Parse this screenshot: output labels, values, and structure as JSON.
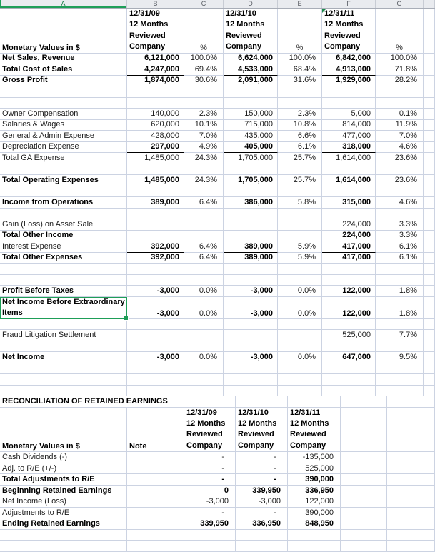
{
  "colors": {
    "selection_green": "#1E9E58",
    "header_letter_green": "#107C41",
    "flag_green": "#1E8A4E",
    "gridline": "#CCD3E2"
  },
  "column_headers": [
    "A",
    "B",
    "C",
    "D",
    "E",
    "F",
    "G",
    ""
  ],
  "income_statement": {
    "corner_label": "Monetary Values in $",
    "percent_symbol": "%",
    "periods": [
      {
        "lines": [
          "12/31/09",
          "12 Months",
          "Reviewed",
          "Company"
        ],
        "flag": false
      },
      {
        "lines": [
          "12/31/10",
          "12 Months",
          "Reviewed",
          "Company"
        ],
        "flag": false
      },
      {
        "lines": [
          "12/31/11",
          "12 Months",
          "Reviewed",
          "Company"
        ],
        "flag": true
      }
    ],
    "rows": [
      {
        "type": "data",
        "label": "Net Sales, Revenue",
        "label_bold": true,
        "value_bold": true,
        "underline": false,
        "cells": [
          "6,121,000",
          "100.0%",
          "6,624,000",
          "100.0%",
          "6,842,000",
          "100.0%"
        ]
      },
      {
        "type": "data",
        "label": "Total Cost of Sales",
        "label_bold": true,
        "value_bold": true,
        "underline": true,
        "cells": [
          "4,247,000",
          "69.4%",
          "4,533,000",
          "68.4%",
          "4,913,000",
          "71.8%"
        ]
      },
      {
        "type": "data",
        "label": "Gross Profit",
        "label_bold": true,
        "value_bold": true,
        "underline": false,
        "cells": [
          "1,874,000",
          "30.6%",
          "2,091,000",
          "31.6%",
          "1,929,000",
          "28.2%"
        ]
      },
      {
        "type": "blank"
      },
      {
        "type": "blank"
      },
      {
        "type": "data",
        "label": "Owner Compensation",
        "label_bold": false,
        "value_bold": false,
        "underline": false,
        "cells": [
          "140,000",
          "2.3%",
          "150,000",
          "2.3%",
          "5,000",
          "0.1%"
        ]
      },
      {
        "type": "data",
        "label": "Salaries & Wages",
        "label_bold": false,
        "value_bold": false,
        "underline": false,
        "cells": [
          "620,000",
          "10.1%",
          "715,000",
          "10.8%",
          "814,000",
          "11.9%"
        ]
      },
      {
        "type": "data",
        "label": "General & Admin Expense",
        "label_bold": false,
        "value_bold": false,
        "underline": false,
        "cells": [
          "428,000",
          "7.0%",
          "435,000",
          "6.6%",
          "477,000",
          "7.0%"
        ]
      },
      {
        "type": "data",
        "label": "Depreciation Expense",
        "label_bold": false,
        "value_bold": true,
        "underline": true,
        "cells": [
          "297,000",
          "4.9%",
          "405,000",
          "6.1%",
          "318,000",
          "4.6%"
        ]
      },
      {
        "type": "data",
        "label": "Total GA Expense",
        "label_bold": false,
        "value_bold": false,
        "underline": false,
        "cells": [
          "1,485,000",
          "24.3%",
          "1,705,000",
          "25.7%",
          "1,614,000",
          "23.6%"
        ]
      },
      {
        "type": "blank"
      },
      {
        "type": "data",
        "label": "Total Operating Expenses",
        "label_bold": true,
        "value_bold": true,
        "underline": false,
        "cells": [
          "1,485,000",
          "24.3%",
          "1,705,000",
          "25.7%",
          "1,614,000",
          "23.6%"
        ]
      },
      {
        "type": "blank"
      },
      {
        "type": "data",
        "label": "Income from Operations",
        "label_bold": true,
        "value_bold": true,
        "underline": false,
        "cells": [
          "389,000",
          "6.4%",
          "386,000",
          "5.8%",
          "315,000",
          "4.6%"
        ]
      },
      {
        "type": "blank"
      },
      {
        "type": "data",
        "label": "Gain (Loss) on Asset Sale",
        "label_bold": false,
        "value_bold": false,
        "underline": false,
        "cells": [
          "",
          "",
          "",
          "",
          "224,000",
          "3.3%"
        ]
      },
      {
        "type": "data",
        "label": "Total Other Income",
        "label_bold": true,
        "value_bold": true,
        "underline": false,
        "cells": [
          "",
          "",
          "",
          "",
          "224,000",
          "3.3%"
        ]
      },
      {
        "type": "data",
        "label": "Interest Expense",
        "label_bold": false,
        "value_bold": true,
        "underline": true,
        "cells": [
          "392,000",
          "6.4%",
          "389,000",
          "5.9%",
          "417,000",
          "6.1%"
        ]
      },
      {
        "type": "data",
        "label": "Total Other Expenses",
        "label_bold": true,
        "value_bold": true,
        "underline": false,
        "cells": [
          "392,000",
          "6.4%",
          "389,000",
          "5.9%",
          "417,000",
          "6.1%"
        ]
      },
      {
        "type": "blank"
      },
      {
        "type": "blank"
      },
      {
        "type": "data",
        "label": "Profit Before Taxes",
        "label_bold": true,
        "value_bold": true,
        "underline": false,
        "cells": [
          "-3,000",
          "0.0%",
          "-3,000",
          "0.0%",
          "122,000",
          "1.8%"
        ]
      },
      {
        "type": "data",
        "label": "Net Income Before Extraordinary Items",
        "label_bold": true,
        "value_bold": true,
        "underline": false,
        "selected": true,
        "cells": [
          "-3,000",
          "0.0%",
          "-3,000",
          "0.0%",
          "122,000",
          "1.8%"
        ]
      },
      {
        "type": "blank"
      },
      {
        "type": "data",
        "label": "Fraud Litigation Settlement",
        "label_bold": false,
        "value_bold": false,
        "underline": false,
        "cells": [
          "",
          "",
          "",
          "",
          "525,000",
          "7.7%"
        ]
      },
      {
        "type": "blank"
      },
      {
        "type": "data",
        "label": "Net Income",
        "label_bold": true,
        "value_bold": true,
        "underline": false,
        "cells": [
          "-3,000",
          "0.0%",
          "-3,000",
          "0.0%",
          "647,000",
          "9.5%"
        ]
      },
      {
        "type": "blank"
      },
      {
        "type": "blank"
      },
      {
        "type": "blank"
      }
    ]
  },
  "reconciliation": {
    "title": "RECONCILIATION OF RETAINED EARNINGS",
    "corner_label": "Monetary Values in $",
    "note_header": "Note",
    "periods": [
      {
        "lines": [
          "12/31/09",
          "12 Months",
          "Reviewed",
          "Company"
        ],
        "flag": false
      },
      {
        "lines": [
          "12/31/10",
          "12 Months",
          "Reviewed",
          "Company"
        ],
        "flag": false
      },
      {
        "lines": [
          "12/31/11",
          "12 Months",
          "Reviewed",
          "Company"
        ],
        "flag": false
      }
    ],
    "rows": [
      {
        "type": "data",
        "label": "Cash Dividends (-)",
        "label_bold": false,
        "value_bold": false,
        "cells": [
          "-",
          "-",
          "-135,000"
        ]
      },
      {
        "type": "data",
        "label": "Adj. to R/E (+/-)",
        "label_bold": false,
        "value_bold": false,
        "cells": [
          "-",
          "-",
          "525,000"
        ]
      },
      {
        "type": "data",
        "label": "Total Adjustments to R/E",
        "label_bold": true,
        "value_bold": true,
        "cells": [
          "-",
          "-",
          "390,000"
        ]
      },
      {
        "type": "data",
        "label": "Beginning Retained Earnings",
        "label_bold": true,
        "value_bold": true,
        "cells": [
          "0",
          "339,950",
          "336,950"
        ]
      },
      {
        "type": "data",
        "label": "Net Income (Loss)",
        "label_bold": false,
        "value_bold": false,
        "cells": [
          "-3,000",
          "-3,000",
          "122,000"
        ]
      },
      {
        "type": "data",
        "label": "Adjustments to R/E",
        "label_bold": false,
        "value_bold": false,
        "cells": [
          "-",
          "-",
          "390,000"
        ]
      },
      {
        "type": "data",
        "label": "Ending Retained Earnings",
        "label_bold": true,
        "value_bold": true,
        "cells": [
          "339,950",
          "336,950",
          "848,950"
        ]
      },
      {
        "type": "blank"
      },
      {
        "type": "blank"
      }
    ]
  },
  "selection": {
    "selected_cell_label": "Net Income Before Extraordinary Items"
  }
}
